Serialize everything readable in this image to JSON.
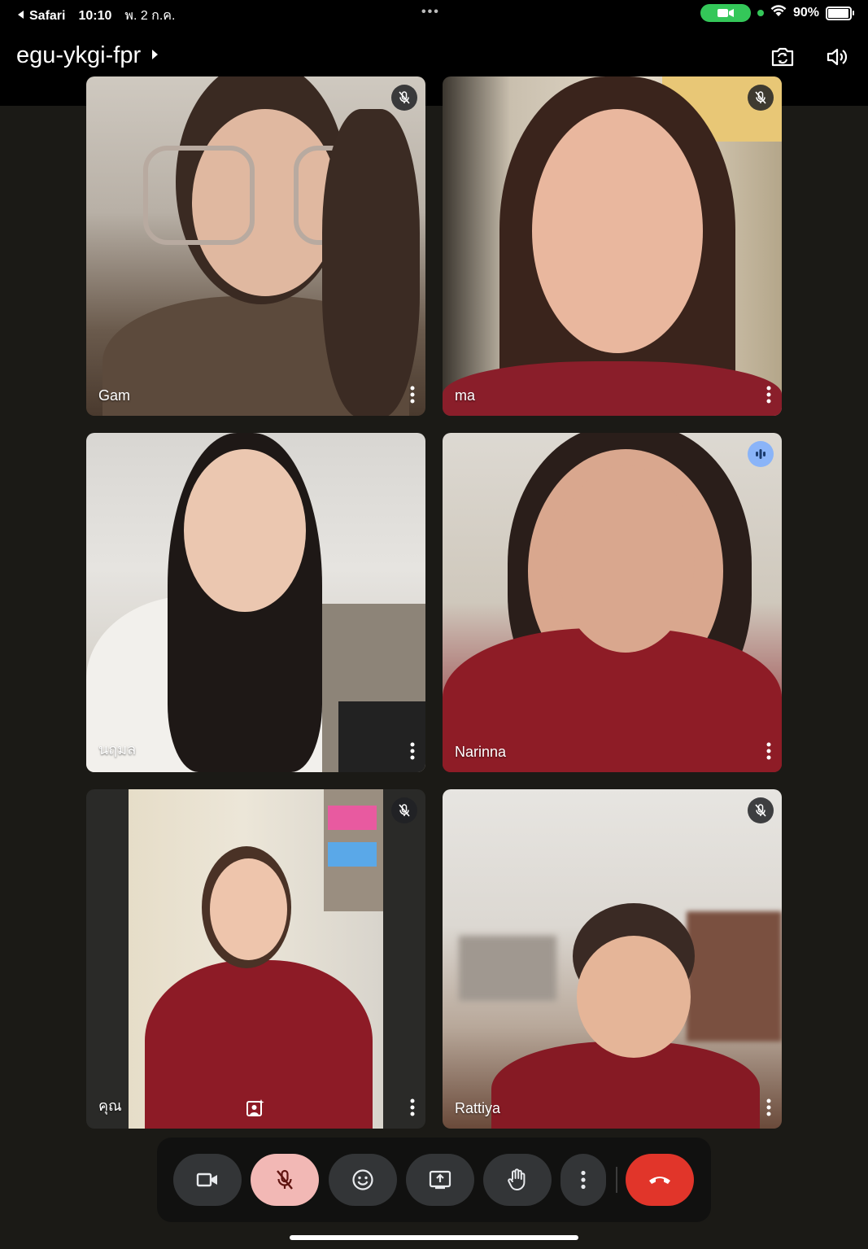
{
  "status_bar": {
    "back_app": "Safari",
    "time": "10:10",
    "date": "พ. 2 ก.ค.",
    "dots": "•••",
    "battery": "90%"
  },
  "header": {
    "meeting_code": "egu-ykgi-fpr",
    "camera_switch_icon": "camera-switch-icon",
    "speaker_icon": "speaker-icon"
  },
  "participants": [
    {
      "name": "Gam",
      "status": "muted"
    },
    {
      "name": "ma",
      "status": "muted"
    },
    {
      "name": "นฤมล",
      "status": "none"
    },
    {
      "name": "Narinna",
      "status": "speaking"
    },
    {
      "name": "คุณ",
      "status": "muted"
    },
    {
      "name": "Rattiya",
      "status": "muted"
    }
  ],
  "controls": {
    "camera": "video-camera-icon",
    "mic": "mic-off-icon",
    "reactions": "emoji-icon",
    "present": "present-screen-icon",
    "raise_hand": "raise-hand-icon",
    "more": "more-vert-icon",
    "hangup": "hang-up-icon"
  },
  "colors": {
    "mic_off_bg": "#f2b8b5",
    "hangup_bg": "#e1352a",
    "speaking_badge": "#8ab4f8",
    "battery_pill": "#34c759"
  }
}
